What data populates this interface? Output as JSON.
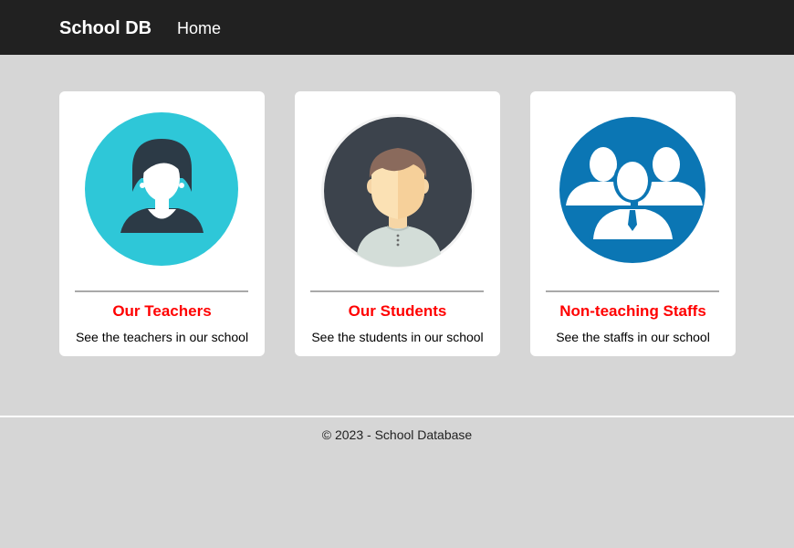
{
  "navbar": {
    "brand": "School DB",
    "links": [
      {
        "label": "Home"
      }
    ]
  },
  "cards": [
    {
      "title": "Our Teachers",
      "description": "See the teachers in our school",
      "icon": "teacher-icon",
      "icon_bg": "#2ec7d8"
    },
    {
      "title": "Our Students",
      "description": "See the students in our school",
      "icon": "student-icon",
      "icon_bg": "#3c434c"
    },
    {
      "title": "Non-teaching Staffs",
      "description": "See the staffs in our school",
      "icon": "staff-group-icon",
      "icon_bg": "#0b76b4"
    }
  ],
  "footer": {
    "text": "© 2023 - School Database"
  },
  "colors": {
    "navbar": "#212121",
    "background": "#d6d6d6",
    "card_title": "#ff0000"
  }
}
